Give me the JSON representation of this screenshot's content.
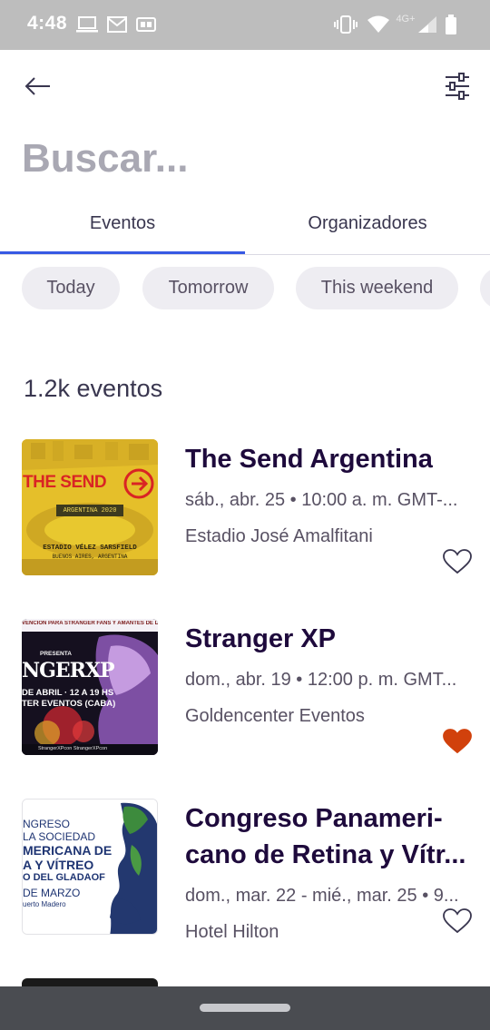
{
  "status_bar": {
    "time": "4:48",
    "network_label": "4G+",
    "icons": [
      "laptop-icon",
      "gmail-icon",
      "ge-badge-icon",
      "vibrate-icon",
      "wifi-icon",
      "signal-icon",
      "battery-icon"
    ]
  },
  "app_bar": {
    "back_icon": "arrow-left-icon",
    "filter_icon": "sliders-icon"
  },
  "search": {
    "placeholder": "Buscar...",
    "value": ""
  },
  "tabs": [
    {
      "label": "Eventos",
      "active": true
    },
    {
      "label": "Organizadores",
      "active": false
    }
  ],
  "chips": [
    {
      "label": "Today"
    },
    {
      "label": "Tomorrow"
    },
    {
      "label": "This weekend"
    }
  ],
  "results": {
    "count_label": "1.2k eventos"
  },
  "events": [
    {
      "title": "The Send Argentina",
      "date": "sáb., abr. 25 • 10:00 a. m. GMT-...",
      "venue": "Estadio José Amalfitani",
      "liked": false,
      "thumb": {
        "headline": "THE SEND",
        "badge": "ARGENTINA 2020",
        "line1": "ESTADIO VÉLEZ SARSFIELD",
        "line2": "BUENOS AIRES, ARGENTINA"
      }
    },
    {
      "title": "Stranger XP",
      "date": "dom., abr. 19 • 12:00 p. m. GMT...",
      "venue": "Goldencenter Eventos",
      "liked": true,
      "thumb": {
        "top_line": "VENCIÓN PARA STRANGER FANS Y AMANTES DE L",
        "presenta": "PRESENTA",
        "logo_text": "NGERXP",
        "line1": "DE ABRIL · 12 A 19 HS",
        "line2": "TER EVENTOS (CABA)",
        "footer": "StrangerXPcon  StrangerXPcon"
      }
    },
    {
      "title": "Congreso Panameri-cano de Retina y Vítr...",
      "date": "dom., mar. 22 - mié., mar. 25 • 9...",
      "venue": "Hotel Hilton",
      "liked": false,
      "thumb": {
        "line1": "NGRESO",
        "line2": "LA SOCIEDAD",
        "line3": "MERICANA DE",
        "line4": "A Y VÍTREO",
        "line5": "O DEL GLADAOF",
        "line6": "DE MARZO",
        "line7": "uerto Madero"
      }
    }
  ],
  "colors": {
    "accent": "#3659e3",
    "liked": "#d1410c",
    "title": "#1e0a3c",
    "muted": "#585163"
  }
}
